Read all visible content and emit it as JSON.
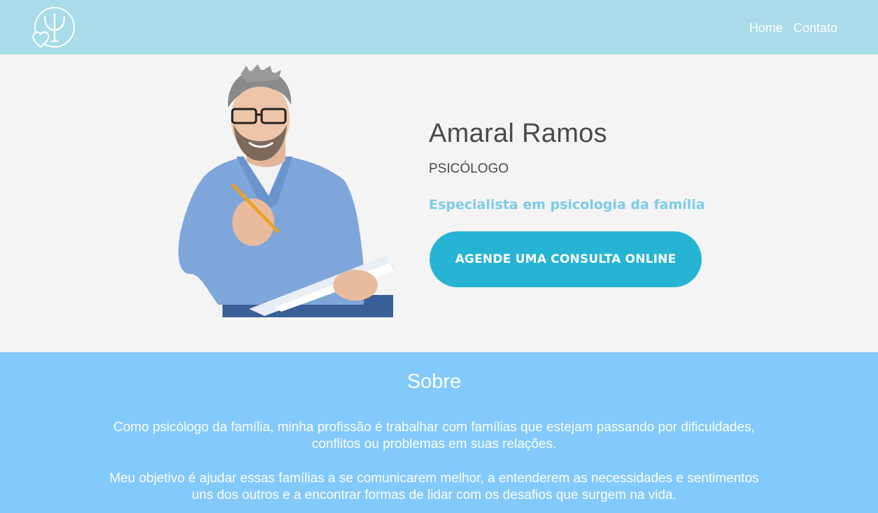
{
  "header": {
    "logo_icon": "psi-heart-logo-icon",
    "nav": [
      {
        "label": "Home"
      },
      {
        "label": "Contato"
      }
    ],
    "background": "#a9dbe8"
  },
  "hero": {
    "portrait_description_icon": "psychologist-portrait",
    "name": "Amaral Ramos",
    "role": "PSICÓLOGO",
    "specialty": "Especialista em psicologia da família",
    "cta_label": "AGENDE UMA CONSULTA ONLINE",
    "colors": {
      "specialty": "#7ccbe8",
      "cta": "#27b4d4"
    }
  },
  "about": {
    "title": "Sobre",
    "paragraphs": [
      "Como psicólogo da família, minha profissão é trabalhar com famílias que estejam passando por dificuldades, conflitos ou problemas em suas relações.",
      "Meu objetivo é ajudar essas famílias a se comunicarem melhor, a entenderem as necessidades e sentimentos uns dos outros e a encontrar formas de lidar com os desafios que surgem na vida."
    ],
    "background": "#82c9fc"
  }
}
